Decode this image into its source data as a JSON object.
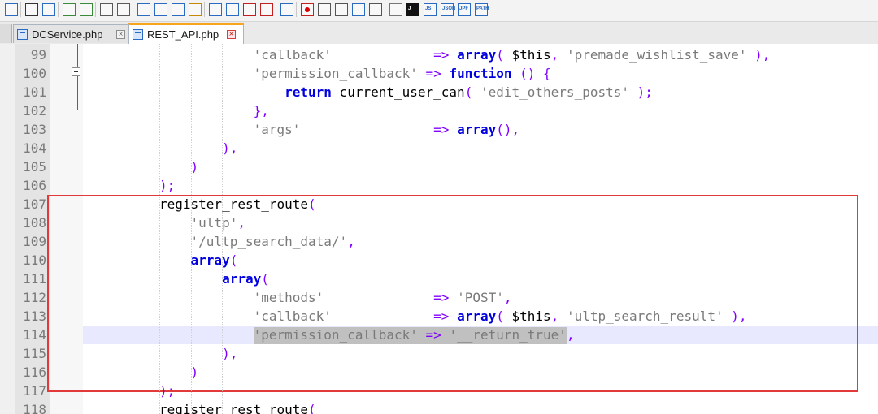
{
  "toolbar": {
    "icons": [
      "replace-icon",
      "binoculars-icon",
      "find-replace-icon",
      "zoom-in-icon",
      "zoom-out-icon",
      "sync-v-icon",
      "sync-h-icon",
      "word-wrap-icon",
      "show-all-chars-icon",
      "indent-guide-icon",
      "doc-map-icon",
      "function-list-icon",
      "folder-workspace-icon",
      "pdf-icon",
      "folder-icon",
      "monitor-icon",
      "record-macro-icon",
      "stop-macro-icon",
      "play-macro-icon",
      "run-macro-multiple-icon",
      "save-macro-icon",
      "filter-icon",
      "jslint-icon",
      "json-tree-icon",
      "jsonviewer-icon",
      "jpf-icon",
      "path-json-icon"
    ],
    "mini_labels": {
      "js": "JS",
      "jpf": "JPF",
      "path": "PATH",
      "json": "JSON",
      "j": "J"
    }
  },
  "tabs": [
    {
      "label": "DCService.php",
      "active": false
    },
    {
      "label": "REST_API.php",
      "active": true
    }
  ],
  "editor": {
    "lines": [
      {
        "num": "99",
        "segments": [
          {
            "t": "            ",
            "c": ""
          },
          {
            "t": "'callback'",
            "c": "s"
          },
          {
            "t": "             ",
            "c": ""
          },
          {
            "t": "=>",
            "c": "p"
          },
          {
            "t": " ",
            "c": ""
          },
          {
            "t": "array",
            "c": "k"
          },
          {
            "t": "(",
            "c": "p"
          },
          {
            "t": " $this",
            "c": "v"
          },
          {
            "t": ",",
            "c": "p"
          },
          {
            "t": " ",
            "c": ""
          },
          {
            "t": "'premade_wishlist_save'",
            "c": "s"
          },
          {
            "t": " ),",
            "c": "p"
          }
        ]
      },
      {
        "num": "100",
        "segments": [
          {
            "t": "            ",
            "c": ""
          },
          {
            "t": "'permission_callback'",
            "c": "s"
          },
          {
            "t": " ",
            "c": ""
          },
          {
            "t": "=>",
            "c": "p"
          },
          {
            "t": " ",
            "c": ""
          },
          {
            "t": "function",
            "c": "k"
          },
          {
            "t": " () {",
            "c": "p"
          }
        ]
      },
      {
        "num": "101",
        "segments": [
          {
            "t": "                ",
            "c": ""
          },
          {
            "t": "return",
            "c": "k"
          },
          {
            "t": " current_user_can",
            "c": "f"
          },
          {
            "t": "(",
            "c": "p"
          },
          {
            "t": " ",
            "c": ""
          },
          {
            "t": "'edit_others_posts'",
            "c": "s"
          },
          {
            "t": " );",
            "c": "p"
          }
        ]
      },
      {
        "num": "102",
        "segments": [
          {
            "t": "            ",
            "c": ""
          },
          {
            "t": "},",
            "c": "p"
          }
        ]
      },
      {
        "num": "103",
        "segments": [
          {
            "t": "            ",
            "c": ""
          },
          {
            "t": "'args'",
            "c": "s"
          },
          {
            "t": "                 ",
            "c": ""
          },
          {
            "t": "=>",
            "c": "p"
          },
          {
            "t": " ",
            "c": ""
          },
          {
            "t": "array",
            "c": "k"
          },
          {
            "t": "(),",
            "c": "p"
          }
        ]
      },
      {
        "num": "104",
        "segments": [
          {
            "t": "        ",
            "c": ""
          },
          {
            "t": "),",
            "c": "p"
          }
        ]
      },
      {
        "num": "105",
        "segments": [
          {
            "t": "    ",
            "c": ""
          },
          {
            "t": ")",
            "c": "p"
          }
        ]
      },
      {
        "num": "106",
        "segments": [
          {
            "t": "",
            "c": ""
          },
          {
            "t": ");",
            "c": "p"
          }
        ]
      },
      {
        "num": "107",
        "segments": [
          {
            "t": "register_rest_route",
            "c": "f"
          },
          {
            "t": "(",
            "c": "p"
          }
        ]
      },
      {
        "num": "108",
        "segments": [
          {
            "t": "    ",
            "c": ""
          },
          {
            "t": "'ultp'",
            "c": "s"
          },
          {
            "t": ",",
            "c": "p"
          }
        ]
      },
      {
        "num": "109",
        "segments": [
          {
            "t": "    ",
            "c": ""
          },
          {
            "t": "'/ultp_search_data/'",
            "c": "s"
          },
          {
            "t": ",",
            "c": "p"
          }
        ]
      },
      {
        "num": "110",
        "segments": [
          {
            "t": "    ",
            "c": ""
          },
          {
            "t": "array",
            "c": "k"
          },
          {
            "t": "(",
            "c": "p"
          }
        ]
      },
      {
        "num": "111",
        "segments": [
          {
            "t": "        ",
            "c": ""
          },
          {
            "t": "array",
            "c": "k"
          },
          {
            "t": "(",
            "c": "p"
          }
        ]
      },
      {
        "num": "112",
        "segments": [
          {
            "t": "            ",
            "c": ""
          },
          {
            "t": "'methods'",
            "c": "s"
          },
          {
            "t": "              ",
            "c": ""
          },
          {
            "t": "=>",
            "c": "p"
          },
          {
            "t": " ",
            "c": ""
          },
          {
            "t": "'POST'",
            "c": "s"
          },
          {
            "t": ",",
            "c": "p"
          }
        ]
      },
      {
        "num": "113",
        "segments": [
          {
            "t": "            ",
            "c": ""
          },
          {
            "t": "'callback'",
            "c": "s"
          },
          {
            "t": "             ",
            "c": ""
          },
          {
            "t": "=>",
            "c": "p"
          },
          {
            "t": " ",
            "c": ""
          },
          {
            "t": "array",
            "c": "k"
          },
          {
            "t": "(",
            "c": "p"
          },
          {
            "t": " $this",
            "c": "v"
          },
          {
            "t": ",",
            "c": "p"
          },
          {
            "t": " ",
            "c": ""
          },
          {
            "t": "'ultp_search_result'",
            "c": "s"
          },
          {
            "t": " ),",
            "c": "p"
          }
        ]
      },
      {
        "num": "114",
        "segments": [
          {
            "t": "            ",
            "c": ""
          },
          {
            "t": "'permission_callback'",
            "c": "s"
          },
          {
            "t": " ",
            "c": ""
          },
          {
            "t": "=>",
            "c": "p"
          },
          {
            "t": " ",
            "c": ""
          },
          {
            "t": "'__return_true'",
            "c": "s"
          },
          {
            "t": ",",
            "c": "p"
          }
        ]
      },
      {
        "num": "115",
        "segments": [
          {
            "t": "        ",
            "c": ""
          },
          {
            "t": "),",
            "c": "p"
          }
        ]
      },
      {
        "num": "116",
        "segments": [
          {
            "t": "    ",
            "c": ""
          },
          {
            "t": ")",
            "c": "p"
          }
        ]
      },
      {
        "num": "117",
        "segments": [
          {
            "t": "",
            "c": ""
          },
          {
            "t": ");",
            "c": "p"
          }
        ]
      },
      {
        "num": "118",
        "segments": [
          {
            "t": "register_rest_route",
            "c": "f"
          },
          {
            "t": "(",
            "c": "p"
          }
        ]
      }
    ],
    "indent_prefix": "    "
  }
}
